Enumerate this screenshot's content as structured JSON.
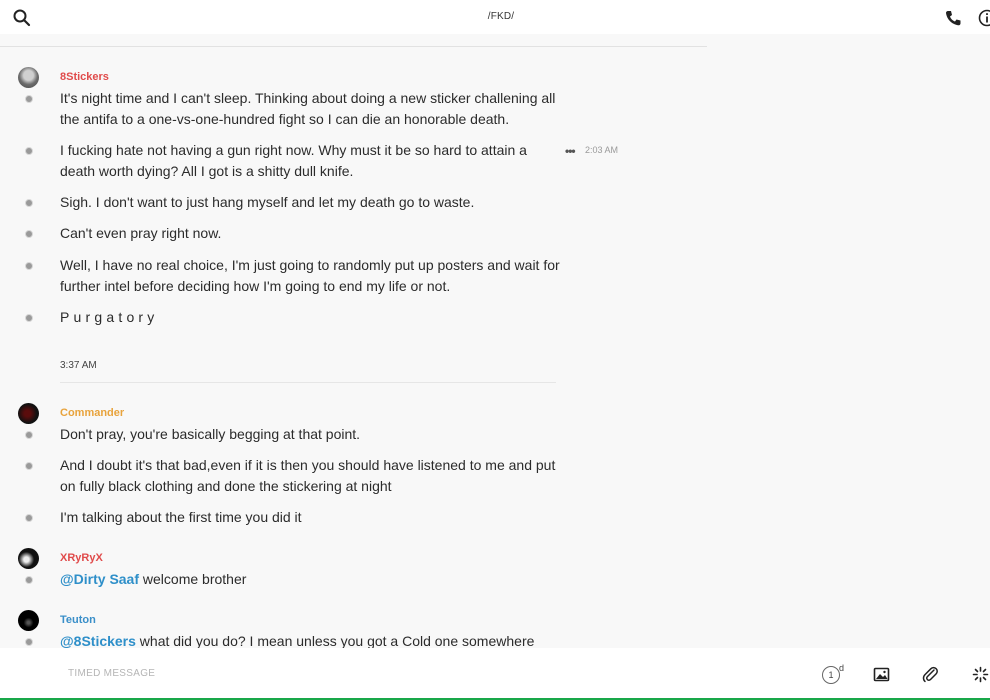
{
  "header": {
    "title": "/FKD/"
  },
  "icons": {
    "search": "search-icon",
    "phone": "phone-icon",
    "info": "info-icon",
    "more": "more-options-icon",
    "image": "image-icon",
    "attach": "paperclip-icon",
    "sparkle": "sparkle-icon",
    "timer": "timer-icon"
  },
  "colors": {
    "8Stickers": "#e04b4b",
    "Commander": "#e8a33c",
    "XRyRyX": "#e04b4b",
    "Teuton": "#3a8fc9",
    "mention": "#2e8fc9"
  },
  "groups": [
    {
      "author": "8Stickers",
      "messages": [
        "It's night time and I can't sleep. Thinking about doing a new sticker challening all the antifa to a one-vs-one-hundred fight so I can die an honorable death.",
        "I fucking hate not having a gun right now. Why must it be so hard to attain a death worth dying? All I got is a shitty dull knife.",
        "Sigh. I don't want to just hang myself and let my death go to waste.",
        "Can't even pray right now.",
        "Well, I have no real choice, I'm just going to randomly put up posters and wait for further intel before deciding how I'm going to end my life or not.",
        "Purgatory"
      ],
      "hover_time": "2:03 AM",
      "hover_more": "•••"
    },
    {
      "separator_time": "3:37 AM"
    },
    {
      "author": "Commander",
      "messages": [
        "Don't pray, you're basically begging at that point.",
        "And I doubt it's that bad,even if it is then you should have listened to me and put on fully black clothing and done the stickering at night",
        "I'm talking about the first time you did it"
      ]
    },
    {
      "author": "XRyRyX",
      "messages": [
        {
          "mention": "@Dirty Saaf",
          "text": " welcome brother"
        }
      ]
    },
    {
      "author": "Teuton",
      "messages": [
        {
          "mention": "@8Stickers",
          "text": " what did you do? I mean unless you got a Cold one somewhere"
        }
      ]
    }
  ],
  "composer": {
    "placeholder": "TIMED MESSAGE",
    "timer_value": "1",
    "timer_unit": "d"
  }
}
